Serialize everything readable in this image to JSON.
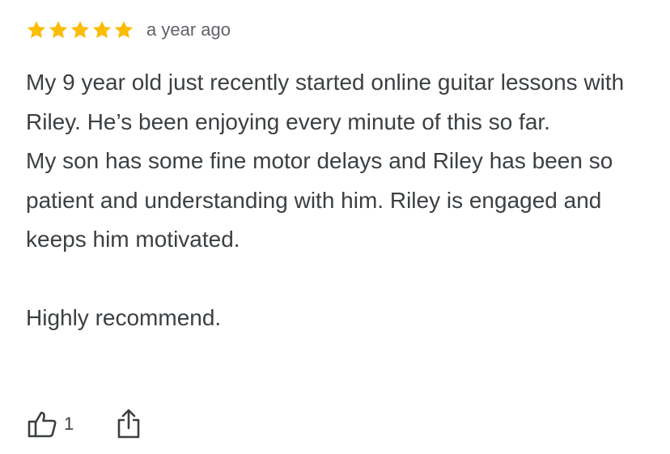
{
  "review": {
    "rating": 5,
    "rating_max": 5,
    "star_color": "#fbbc04",
    "age": "a year ago",
    "paragraphs": [
      "My 9 year old just recently started online guitar lessons with Riley. He’s been enjoying every minute of this so far.",
      "My son has some fine motor delays and Riley has been so patient and understanding with him. Riley is engaged and keeps him motivated.",
      "",
      "Highly recommend."
    ]
  },
  "actions": {
    "like_icon": "thumbs-up-icon",
    "like_count": "1",
    "share_icon": "share-icon"
  }
}
